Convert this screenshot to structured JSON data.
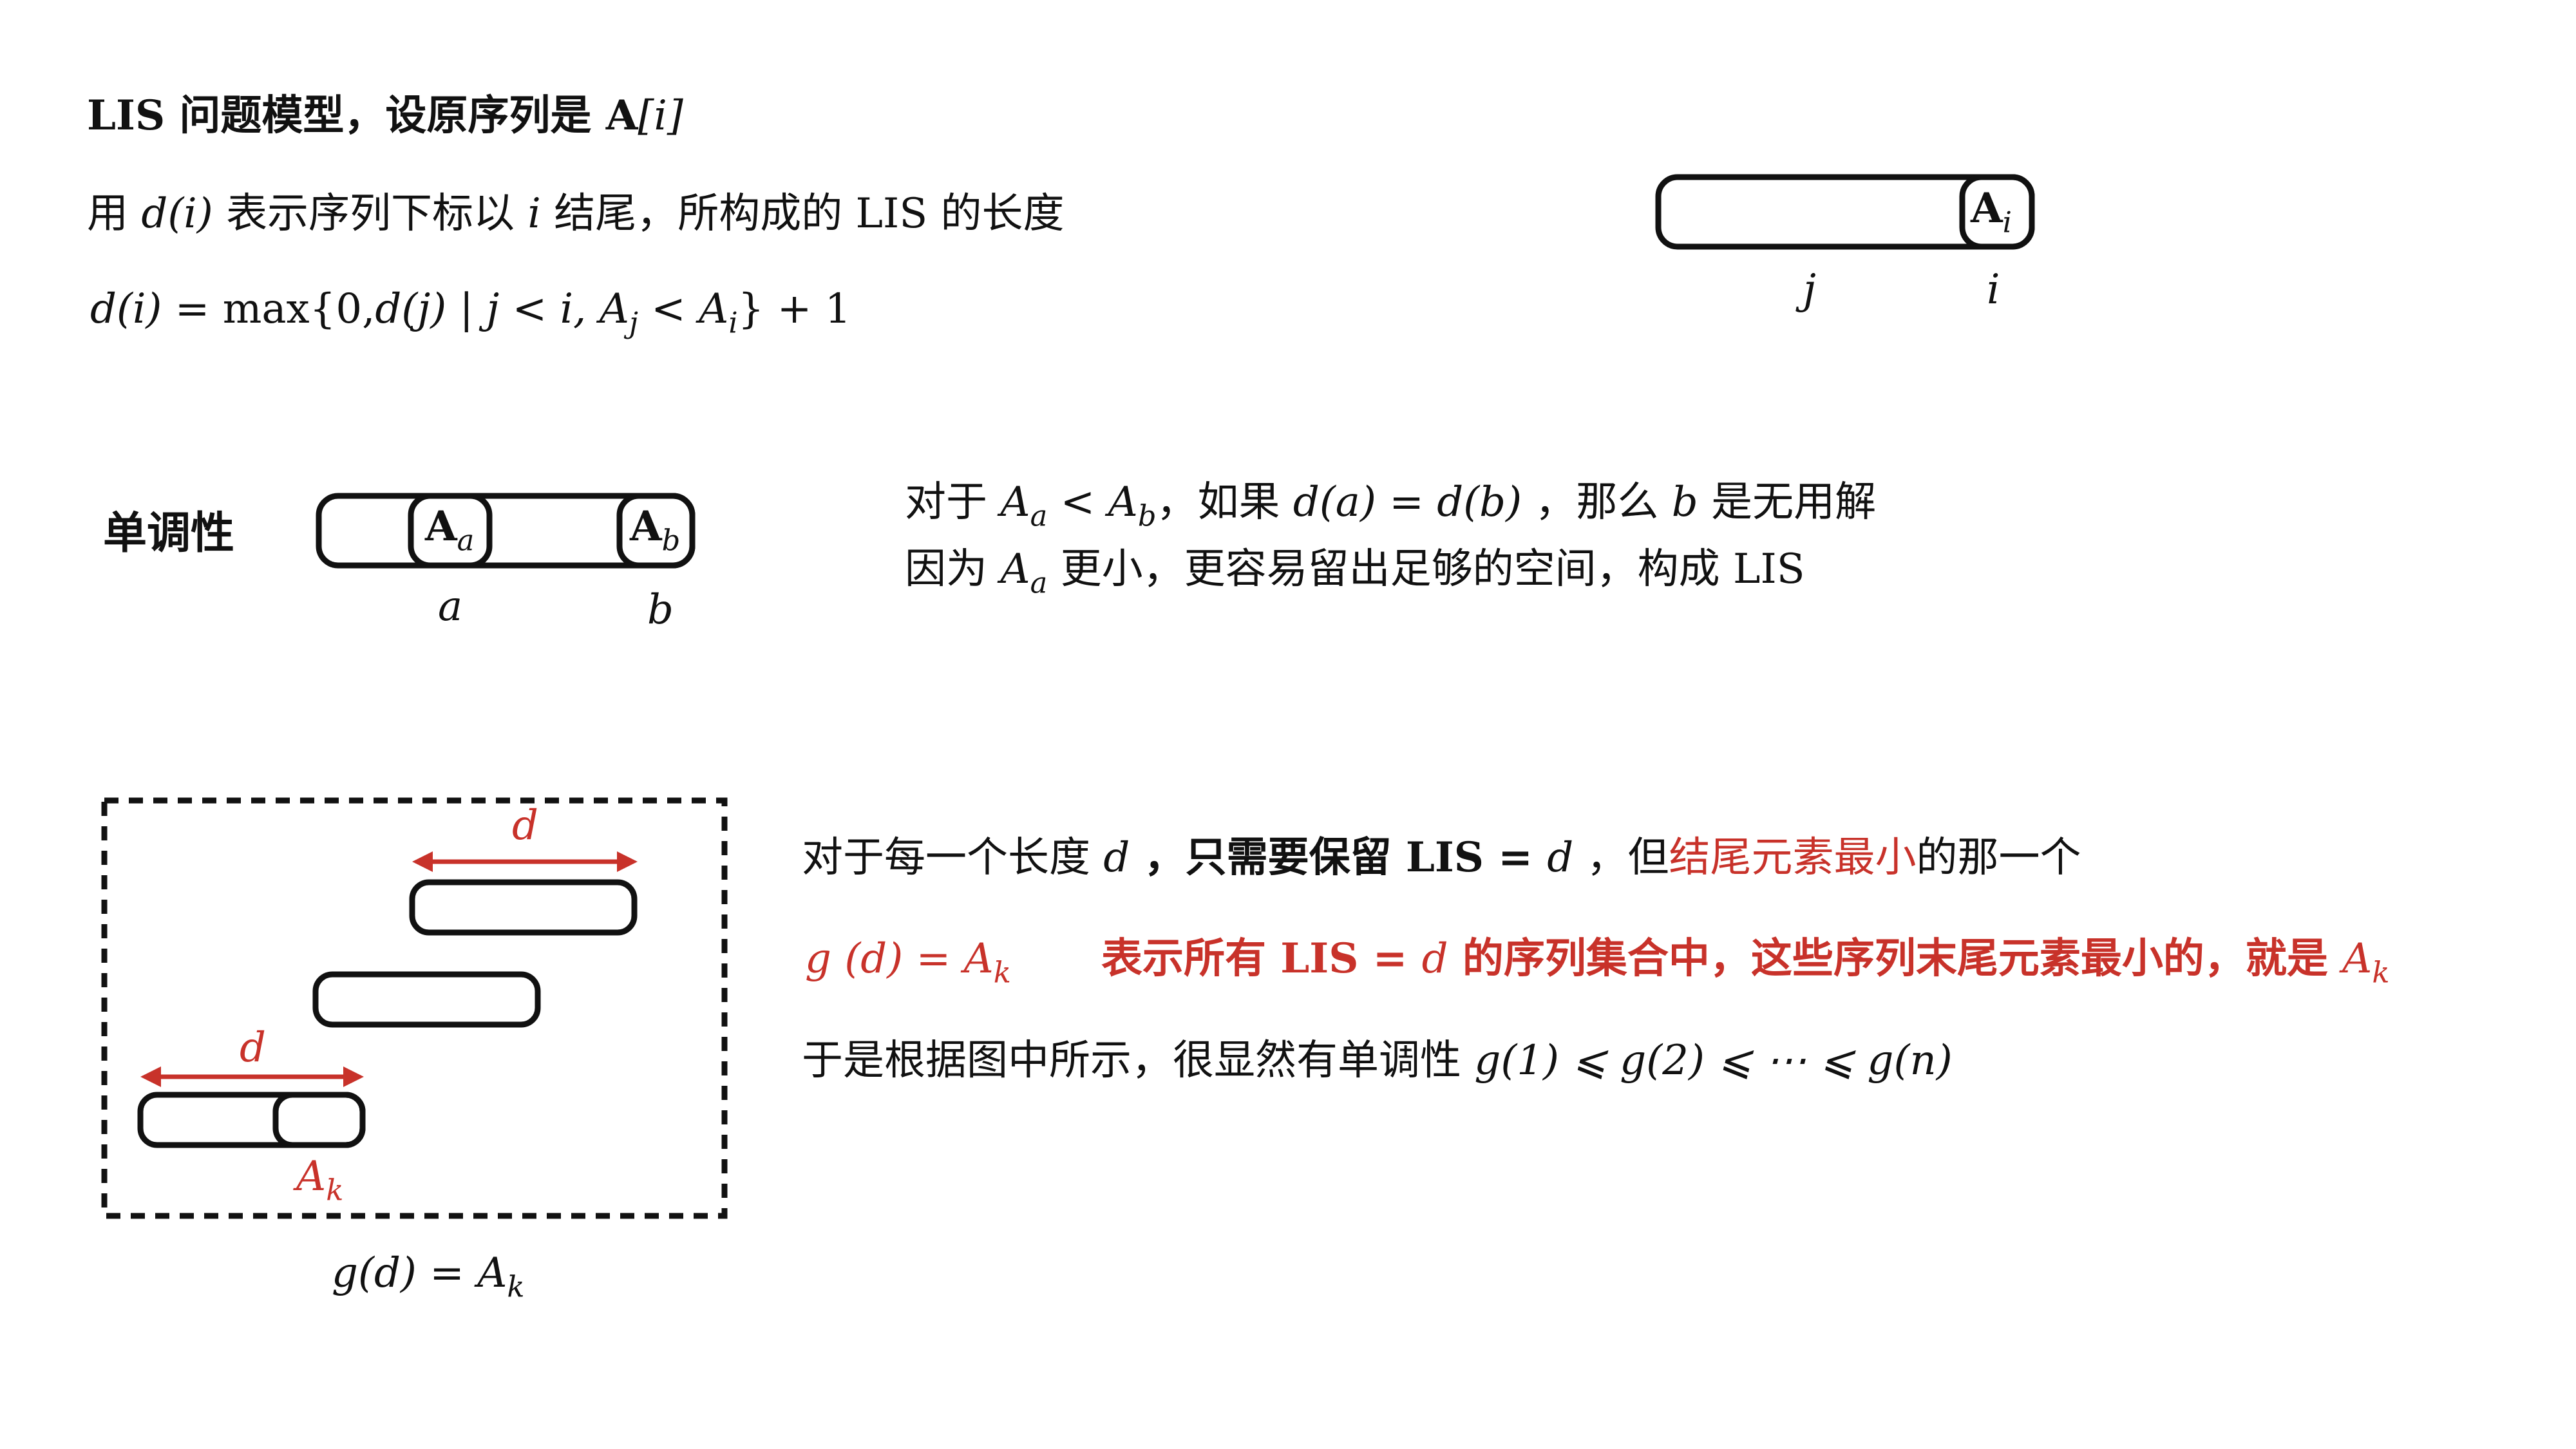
{
  "colors": {
    "accent_red": "#c8322a",
    "ink": "#111111"
  },
  "section1": {
    "title_prefix": "LIS 问题模型，设原序列是 ",
    "title_A": "A",
    "title_idx": "[i]",
    "def_pre": "用 ",
    "def_d": "d",
    "def_i": "(i)",
    "def_mid": " 表示序列下标以 ",
    "def_i2": "i",
    "def_post": " 结尾，所构成的 LIS 的长度",
    "formula_lhs": "d(i)",
    "formula_mid": " = max{0,",
    "formula_dj": "d(j)",
    "formula_bar": " | ",
    "formula_cond1": "j < i, A",
    "formula_sub_j": "j",
    "formula_lt": " < A",
    "formula_sub_i": "i",
    "formula_tail": "} + 1",
    "box_label_A": "A",
    "box_label_sub": "i",
    "pos_j": "j",
    "pos_i": "i"
  },
  "section2": {
    "label": "单调性",
    "box_a_A": "A",
    "box_a_sub": "a",
    "box_b_A": "A",
    "box_b_sub": "b",
    "pos_a": "a",
    "pos_b": "b",
    "line1_pre": "对于 ",
    "line1_Aa": "A",
    "line1_sub_a": "a",
    "line1_lt": " < ",
    "line1_Ab": "A",
    "line1_sub_b": "b",
    "line1_mid": "，如果 ",
    "line1_da": "d(a) = d(b)",
    "line1_sep": " ，那么 ",
    "line1_b": "b",
    "line1_post": " 是无用解",
    "line2_pre": "因为 ",
    "line2_A": "A",
    "line2_sub": "a",
    "line2_post": " 更小，更容易留出足够的空间，构成 LIS"
  },
  "section3": {
    "arrow_label_top": "d",
    "arrow_label_bottom": "d",
    "box_label_A": "A",
    "box_label_sub": "k",
    "caption_g": "g(d) = A",
    "caption_sub": "k",
    "line1_pre": "对于每一个长度 ",
    "line1_d": "d",
    "line1_mid": " ，只需要保留 LIS = ",
    "line1_d2": "d",
    "line1_mid2": " ，但",
    "line1_red": "结尾元素最小",
    "line1_post": "的那一个",
    "line2_g": "g",
    "line2_paren": " (d) = A",
    "line2_sub": "k",
    "line2_text": "表示所有 LIS  = ",
    "line2_d": "d",
    "line2_text2": " 的序列集合中，这些序列末尾元素最小的，就是 ",
    "line2_A": "A",
    "line2_sub2": "k",
    "line3_pre": "于是根据图中所示，很显然有单调性 ",
    "line3_math": "g(1) ⩽ g(2) ⩽ ⋯ ⩽ g(n)"
  }
}
